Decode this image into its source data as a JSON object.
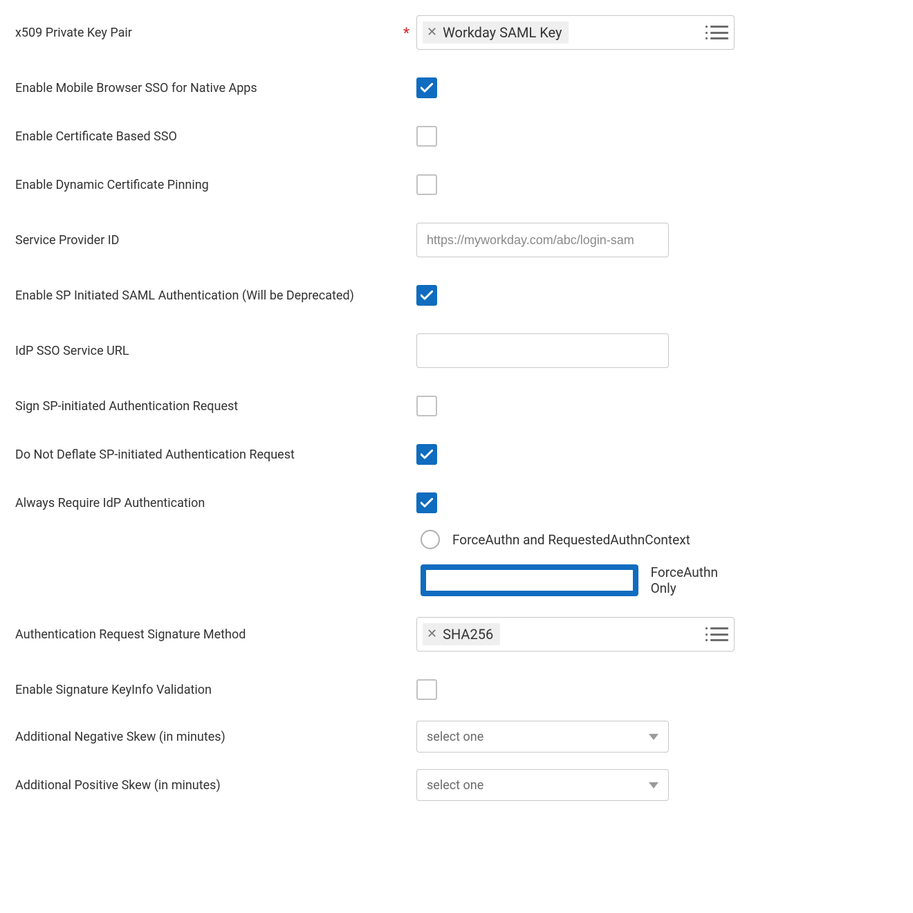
{
  "fields": {
    "x509": {
      "label": "x509 Private Key Pair",
      "required": true,
      "chip": "Workday SAML Key"
    },
    "mobile_sso": {
      "label": "Enable Mobile Browser SSO for Native Apps",
      "checked": true
    },
    "cert_sso": {
      "label": "Enable Certificate Based SSO",
      "checked": false
    },
    "dyn_pin": {
      "label": "Enable Dynamic Certificate Pinning",
      "checked": false
    },
    "sp_id": {
      "label": "Service Provider ID",
      "placeholder": "https://myworkday.com/abc/login-sam"
    },
    "sp_init": {
      "label": "Enable SP Initiated SAML Authentication (Will be Deprecated)",
      "checked": true
    },
    "idp_url": {
      "label": "IdP SSO Service URL",
      "value": ""
    },
    "sign_sp": {
      "label": "Sign SP-initiated Authentication Request",
      "checked": false
    },
    "no_deflate": {
      "label": "Do Not Deflate SP-initiated Authentication Request",
      "checked": true
    },
    "always_idp": {
      "label": "Always Require IdP Authentication",
      "checked": true
    },
    "radio": {
      "opt1": "ForceAuthn and RequestedAuthnContext",
      "opt2": "ForceAuthn Only",
      "selected": "opt2"
    },
    "sig_method": {
      "label": "Authentication Request Signature Method",
      "chip": "SHA256"
    },
    "keyinfo": {
      "label": "Enable Signature KeyInfo Validation",
      "checked": false
    },
    "neg_skew": {
      "label": "Additional Negative Skew (in minutes)",
      "placeholder": "select one"
    },
    "pos_skew": {
      "label": "Additional Positive Skew (in minutes)",
      "placeholder": "select one"
    }
  }
}
